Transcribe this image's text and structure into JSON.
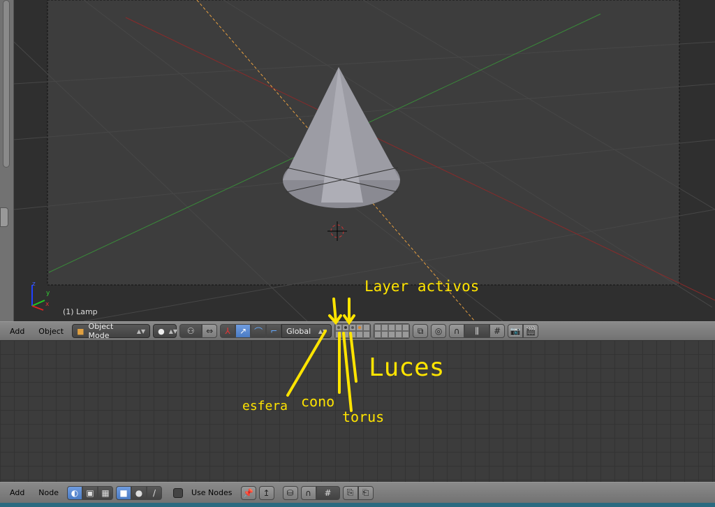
{
  "viewport": {
    "object_label": "(1) Lamp",
    "axes": {
      "x": "x",
      "y": "y",
      "z": "z"
    }
  },
  "view3d_header": {
    "menus": [
      "Add",
      "Object"
    ],
    "mode": "Object Mode",
    "orientation": "Global",
    "active_layer_color": "#e08a30"
  },
  "node_header": {
    "menus": [
      "Add",
      "Node"
    ],
    "use_nodes_label": "Use Nodes"
  },
  "annotations": {
    "layers": "Layer activos",
    "lights": "Luces",
    "sphere": "esfera",
    "cone": "cono",
    "torus": "torus"
  }
}
